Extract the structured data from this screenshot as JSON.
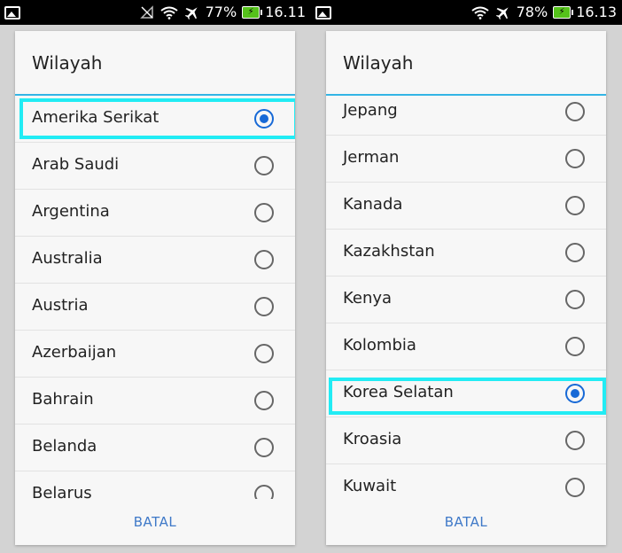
{
  "left": {
    "status": {
      "battery_percent": "77%",
      "time": "16.11"
    },
    "dialog": {
      "title": "Wilayah",
      "items": [
        {
          "label": "Amerika Serikat",
          "selected": true
        },
        {
          "label": "Arab Saudi",
          "selected": false
        },
        {
          "label": "Argentina",
          "selected": false
        },
        {
          "label": "Australia",
          "selected": false
        },
        {
          "label": "Austria",
          "selected": false
        },
        {
          "label": "Azerbaijan",
          "selected": false
        },
        {
          "label": "Bahrain",
          "selected": false
        },
        {
          "label": "Belanda",
          "selected": false
        },
        {
          "label": "Belarus",
          "selected": false
        }
      ],
      "cancel": "BATAL"
    }
  },
  "right": {
    "status": {
      "battery_percent": "78%",
      "time": "16.13"
    },
    "dialog": {
      "title": "Wilayah",
      "items": [
        {
          "label": "Jepang",
          "selected": false
        },
        {
          "label": "Jerman",
          "selected": false
        },
        {
          "label": "Kanada",
          "selected": false
        },
        {
          "label": "Kazakhstan",
          "selected": false
        },
        {
          "label": "Kenya",
          "selected": false
        },
        {
          "label": "Kolombia",
          "selected": false
        },
        {
          "label": "Korea Selatan",
          "selected": true
        },
        {
          "label": "Kroasia",
          "selected": false
        },
        {
          "label": "Kuwait",
          "selected": false
        }
      ],
      "cancel": "BATAL"
    }
  },
  "colors": {
    "accent_divider": "#33b5e5",
    "radio_selected": "#1769d6",
    "highlight_box": "#22ecf4",
    "button_text": "#3f79c8",
    "battery": "#55c21b"
  },
  "icons": [
    "image-notification-icon",
    "signal-off-icon",
    "wifi-icon",
    "airplane-mode-icon",
    "battery-charging-icon"
  ]
}
